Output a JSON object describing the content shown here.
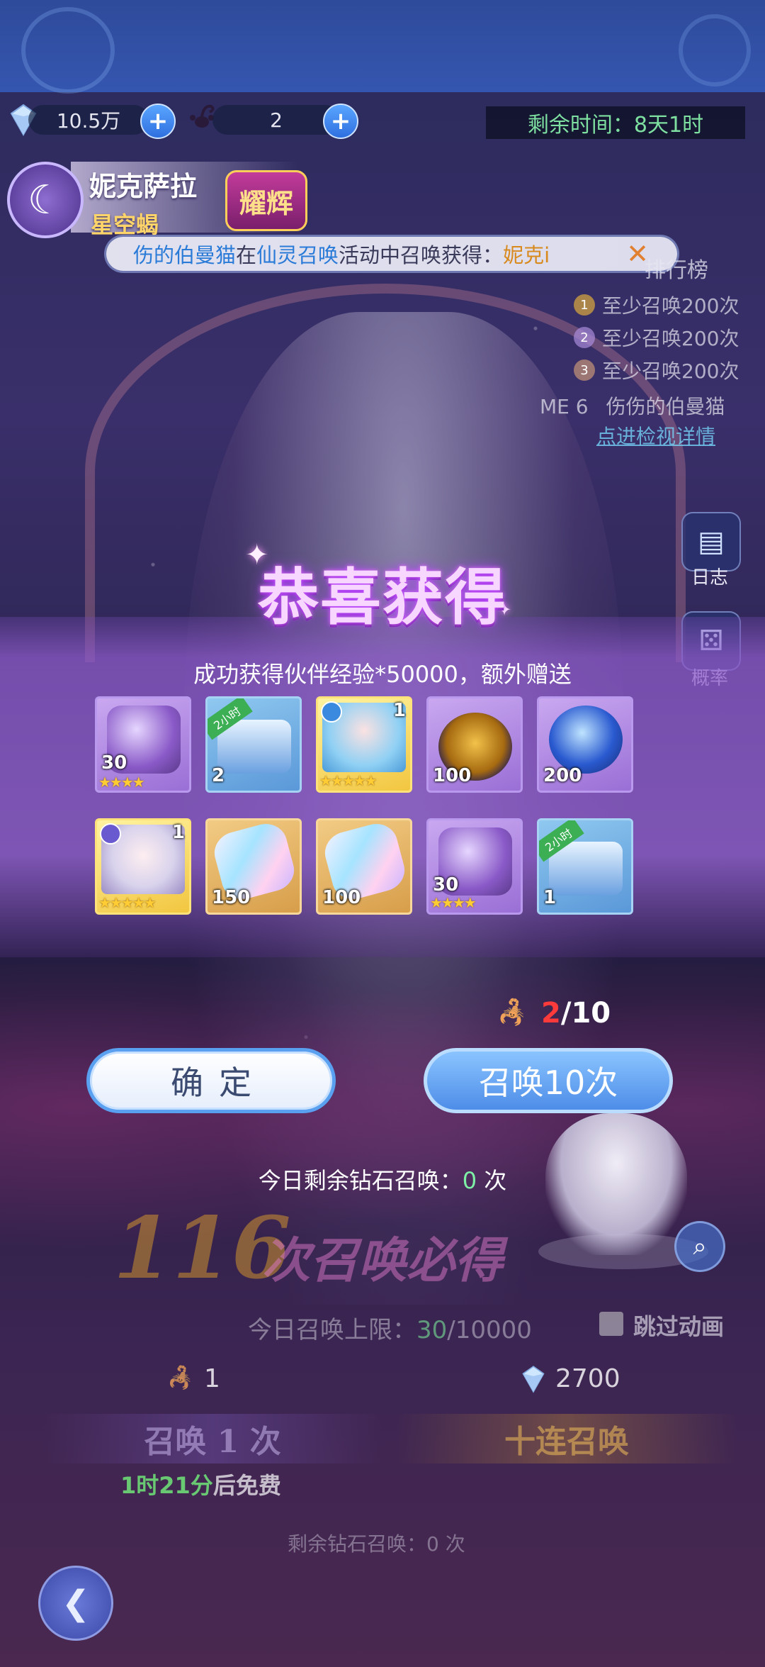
{
  "resources": [
    {
      "icon": "diamond-icon",
      "value": "10.5万"
    },
    {
      "icon": "scorpion-icon",
      "value": "2"
    }
  ],
  "timer": "剩余时间：8天1时",
  "hero": {
    "name": "妮克萨拉",
    "subtitle": "星空蝎",
    "badge": "耀辉"
  },
  "marquee": {
    "player": "伤的伯曼猫",
    "mid1": "在",
    "activity": "仙灵召唤",
    "mid2": "活动中召唤获得：",
    "item": "妮克i"
  },
  "ranking": {
    "title": "排行榜",
    "rows": [
      {
        "rank": "1",
        "text": "至少召唤200次"
      },
      {
        "rank": "2",
        "text": "至少召唤200次"
      },
      {
        "rank": "3",
        "text": "至少召唤200次"
      }
    ],
    "me_label": "ME 6",
    "me_name": "伤伤的伯曼猫",
    "link": "点进检视详情"
  },
  "side_buttons": [
    {
      "icon": "log-icon",
      "label": "日志"
    },
    {
      "icon": "dice-icon",
      "label": "概率"
    }
  ],
  "rewards": {
    "title": "恭喜获得",
    "message": "成功获得伙伴经验*50000，额外赠送",
    "items": [
      {
        "name": "purple-crystal",
        "qty": "30",
        "frame": "purple",
        "stars": "★★★★"
      },
      {
        "name": "treasure-chest",
        "qty": "2",
        "frame": "blue",
        "tag": "2小时"
      },
      {
        "name": "hero-card-blue-hair",
        "count": "1",
        "frame": "hero",
        "stars": "★★★★★"
      },
      {
        "name": "golden-egg",
        "qty": "100",
        "frame": "purple"
      },
      {
        "name": "crystal-orb",
        "qty": "200",
        "frame": "purple"
      },
      {
        "name": "hero-card-nikesala",
        "count": "1",
        "frame": "hero",
        "stars": "★★★★★"
      },
      {
        "name": "rainbow-diamond",
        "qty": "150",
        "frame": "gold"
      },
      {
        "name": "rainbow-diamond",
        "qty": "100",
        "frame": "gold"
      },
      {
        "name": "purple-crystal",
        "qty": "30",
        "frame": "purple",
        "stars": "★★★★"
      },
      {
        "name": "rose-chest",
        "qty": "1",
        "frame": "blue",
        "tag": "2小时"
      }
    ]
  },
  "progress": {
    "current": "2",
    "total": "/10"
  },
  "buttons": {
    "ok": "确定",
    "summon10": "召唤10次"
  },
  "diamond_summons": {
    "prefix": "今日剩余钻石召唤：",
    "value": "0",
    "suffix": " 次"
  },
  "background": {
    "guarantee_number": "116",
    "guarantee_text": "次召唤必得",
    "limit_prefix": "今日召唤上限：",
    "limit_current": "30",
    "limit_total": "/10000",
    "skip_label": "跳过动画",
    "scorpion_count": "1",
    "diamond_cost": "2700",
    "summon_once": "召唤 1 次",
    "summon_ten": "十连召唤",
    "free_time": "1时21分",
    "free_suffix": "后免费",
    "remaining_prefix": "剩余钻石召唤：",
    "remaining_value": "0",
    "remaining_suffix": " 次"
  },
  "colors": {
    "accent": "#4e8de8",
    "highlight_red": "#ff3a3a",
    "highlight_green": "#7ef0a6"
  }
}
